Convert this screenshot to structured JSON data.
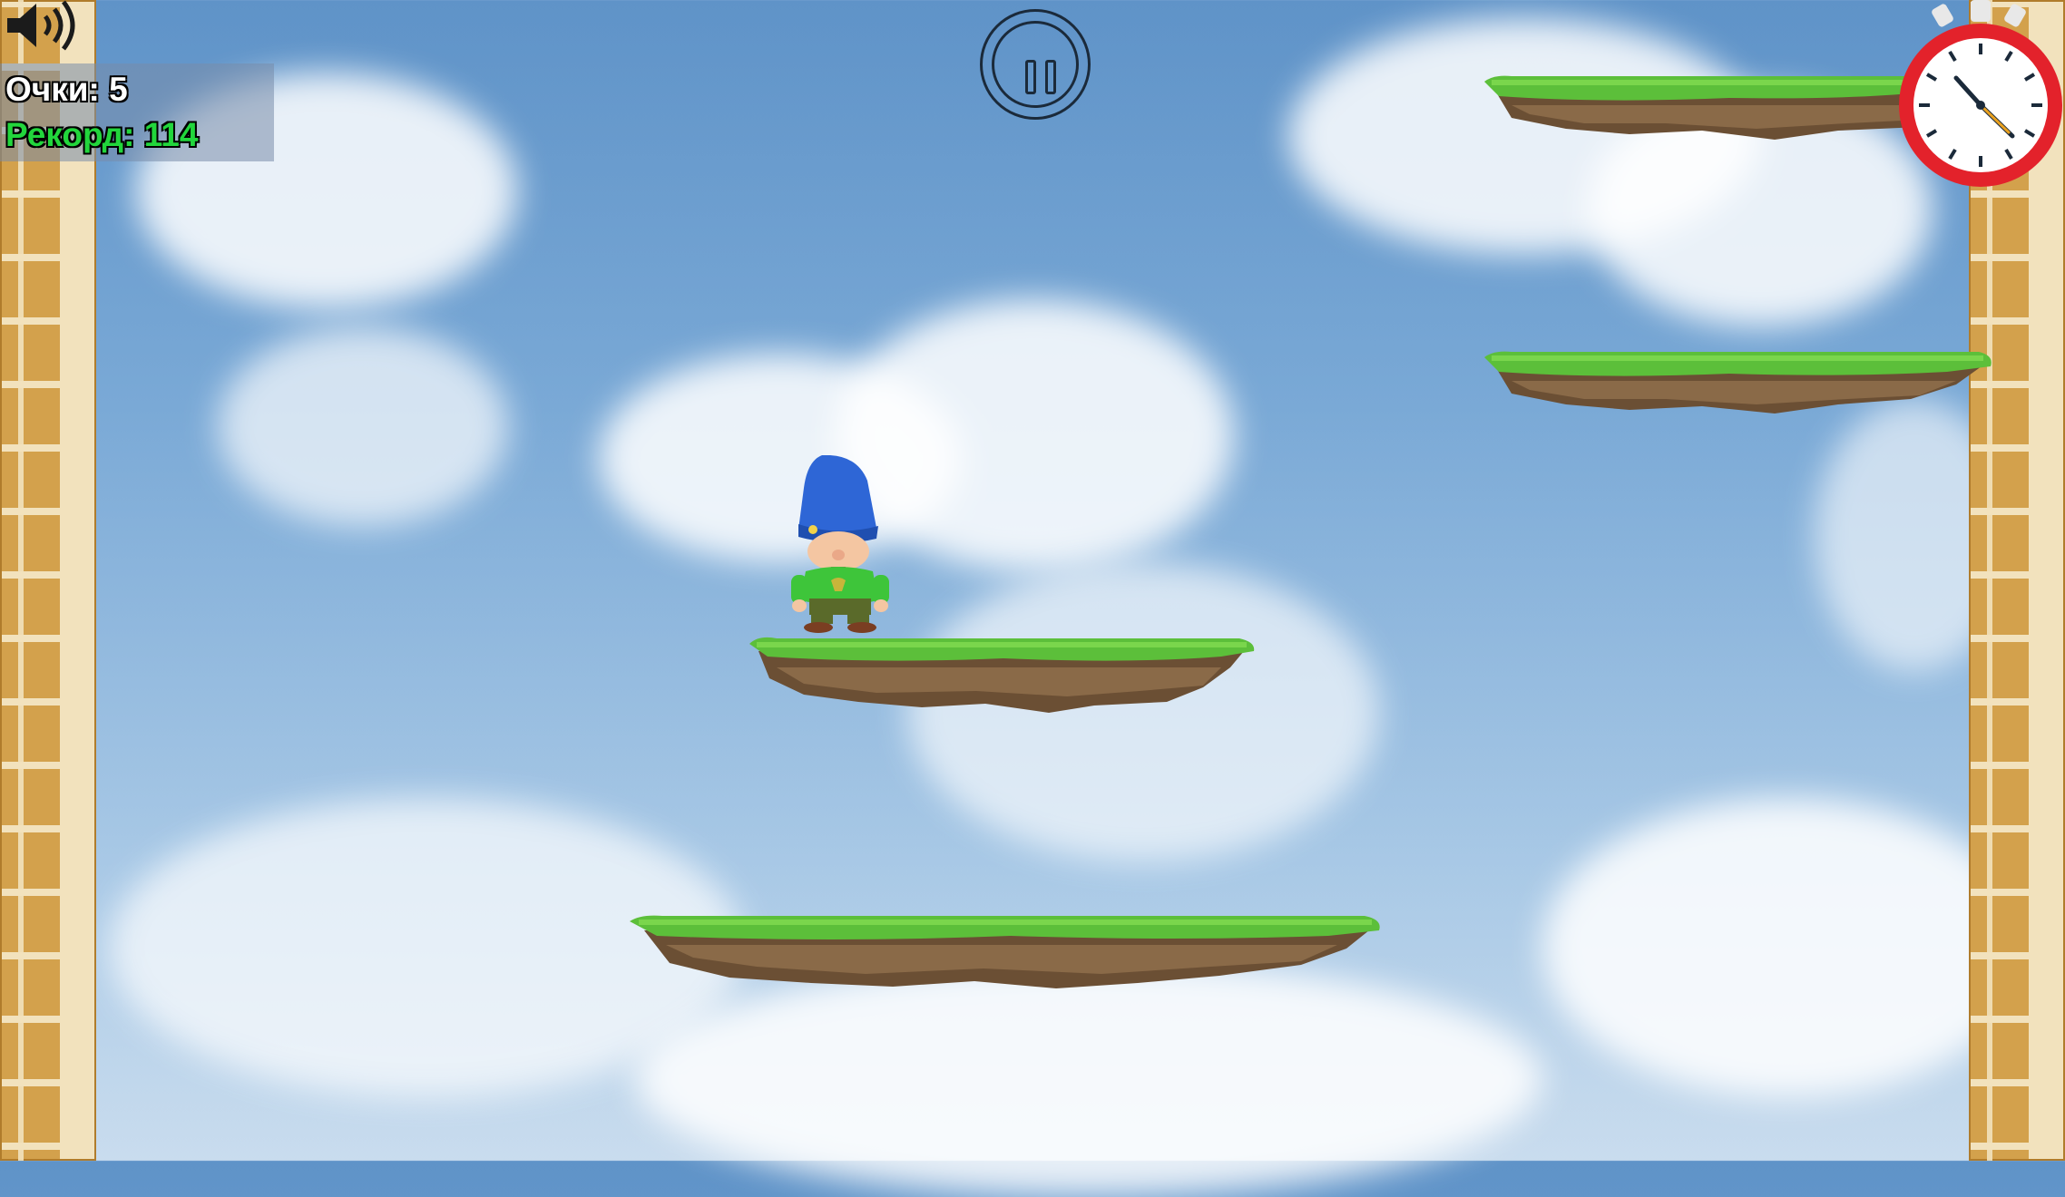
{
  "hud": {
    "score_label": "Очки: 5",
    "record_label": "Рекорд: 114",
    "score_color": "#ffffff",
    "record_color": "#22d63c"
  },
  "controls": {
    "sound_icon": "speaker-volume-icon",
    "pause_icon": "pause-icon"
  },
  "timer": {
    "icon": "stopwatch-icon",
    "rim_color": "#e3222b"
  },
  "player": {
    "name": "gnome",
    "hat_color": "#2e66d6",
    "shirt_color": "#3ec53a"
  }
}
